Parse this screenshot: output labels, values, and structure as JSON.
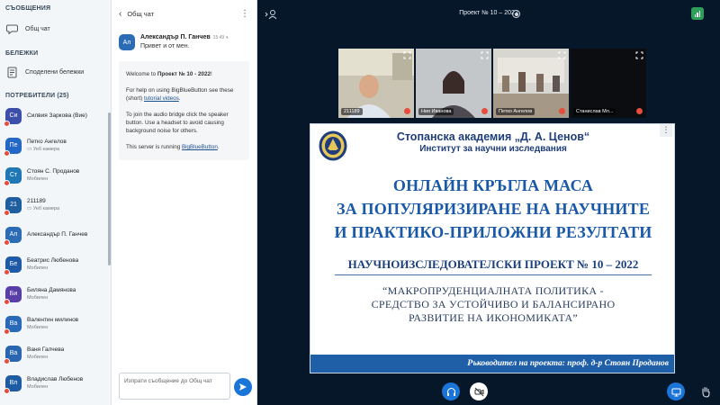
{
  "sidebar": {
    "messages_title": "СЪОБЩЕНИЯ",
    "public_chat": "Общ чат",
    "notes_title": "БЕЛЕЖКИ",
    "shared_notes": "Споделени бележки",
    "users_title": "ПОТРЕБИТЕЛИ (25)",
    "users": [
      {
        "initials": "Си",
        "name": "Силвия Заркова (Вие)",
        "sub": "",
        "color": "#3d4fa8"
      },
      {
        "initials": "Пе",
        "name": "Петко Ангелов",
        "sub": "▭ Уеб камера",
        "color": "#2368c4"
      },
      {
        "initials": "Ст",
        "name": "Стоян С. Проданов",
        "sub": "Мобилен",
        "color": "#1f77b4"
      },
      {
        "initials": "21",
        "name": "211189",
        "sub": "▭ Уеб камера",
        "color": "#1f5fa0"
      },
      {
        "initials": "Ал",
        "name": "Александър П. Ганчев",
        "sub": "",
        "color": "#2b6cb5"
      },
      {
        "initials": "Бе",
        "name": "Беатрис Любенова",
        "sub": "Мобилен",
        "color": "#1e5aa8"
      },
      {
        "initials": "Би",
        "name": "Биляна Дамянова",
        "sub": "Мобилен",
        "color": "#5a3ea8"
      },
      {
        "initials": "Ва",
        "name": "Валентин милинов",
        "sub": "Мобилен",
        "color": "#2869b8"
      },
      {
        "initials": "Ва",
        "name": "Ваня Галчева",
        "sub": "Мобилен",
        "color": "#2a66b0"
      },
      {
        "initials": "Вл",
        "name": "Владислав Любенов",
        "sub": "Мобилен",
        "color": "#1d5ca3"
      }
    ]
  },
  "chat": {
    "title": "Общ чат",
    "message": {
      "initials": "Ал",
      "author": "Александър П. Ганчев",
      "time": "15:49 ч.",
      "text": "Привет и от мен."
    },
    "welcome": {
      "w1_pre": "Welcome to ",
      "w1_bold": "Проект № 10 - 2022",
      "w1_post": "!",
      "w2_pre": "For help on using BigBlueButton see these (short) ",
      "w2_link": "tutorial videos",
      "w2_post": ".",
      "w3": "To join the audio bridge click the speaker button. Use a headset to avoid causing background noise for others.",
      "w4_pre": "This server is running ",
      "w4_link": "BigBlueButton",
      "w4_post": "."
    },
    "input_placeholder": "Изпрати съобщение до Общ чат"
  },
  "main": {
    "meeting_title": "Проект № 10 – 2022",
    "tiles": [
      {
        "name": "211189"
      },
      {
        "name": "Ния Иванова"
      },
      {
        "name": "Петко Ангелов"
      },
      {
        "name": "Станислав Мл..."
      }
    ]
  },
  "slide": {
    "head1": "Стопанска академия „Д. А. Ценов“",
    "head2": "Институт за научни изследвания",
    "line1": "ОНЛАЙН КРЪГЛА МАСА",
    "line2": "ЗА ПОПУЛЯРИЗИРАНЕ НА НАУЧНИТЕ",
    "line3": "И ПРАКТИКО-ПРИЛОЖНИ РЕЗУЛТАТИ",
    "project": "НАУЧНОИЗСЛЕДОВАТЕЛСКИ ПРОЕКТ № 10 – 2022",
    "quote1": "“МАКРОПРУДЕНЦИАЛНАТА ПОЛИТИКА -",
    "quote2": "СРЕДСТВО ЗА УСТОЙЧИВО И БАЛАНСИРАНО",
    "quote3": "РАЗВИТИЕ НА ИКОНОМИКАТА”",
    "footer": "Ръководител на проекта: проф. д-р Стоян Проданов"
  }
}
